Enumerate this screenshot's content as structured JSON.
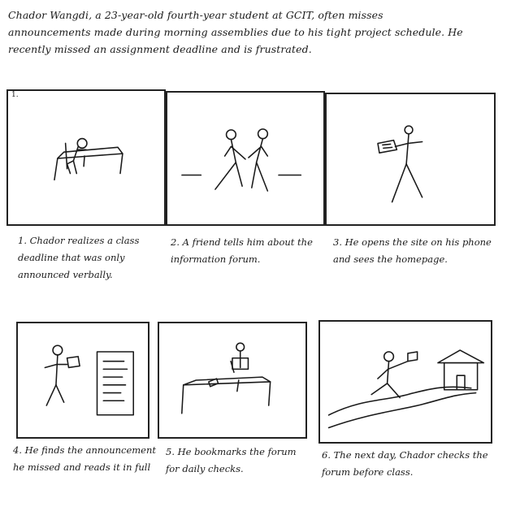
{
  "intro": "Chador Wangdi, a 23-year-old fourth-year student at GCIT, often misses announcements made during morning assemblies due to his tight project schedule. He recently missed an assignment deadline and is frustrated.",
  "panels": [
    {
      "number": "1.",
      "caption": "1. Chador realizes a class deadline that was only announced verbally."
    },
    {
      "number": "",
      "caption": "2. A friend tells him about the information forum."
    },
    {
      "number": "",
      "caption": "3. He opens the site on his phone and sees the homepage."
    },
    {
      "number": "",
      "caption": "4. He finds the announcement he missed and reads it in full"
    },
    {
      "number": "",
      "caption": "5. He bookmarks the forum for daily checks."
    },
    {
      "number": "",
      "caption": "6. The next day, Chador checks the forum before class."
    }
  ]
}
